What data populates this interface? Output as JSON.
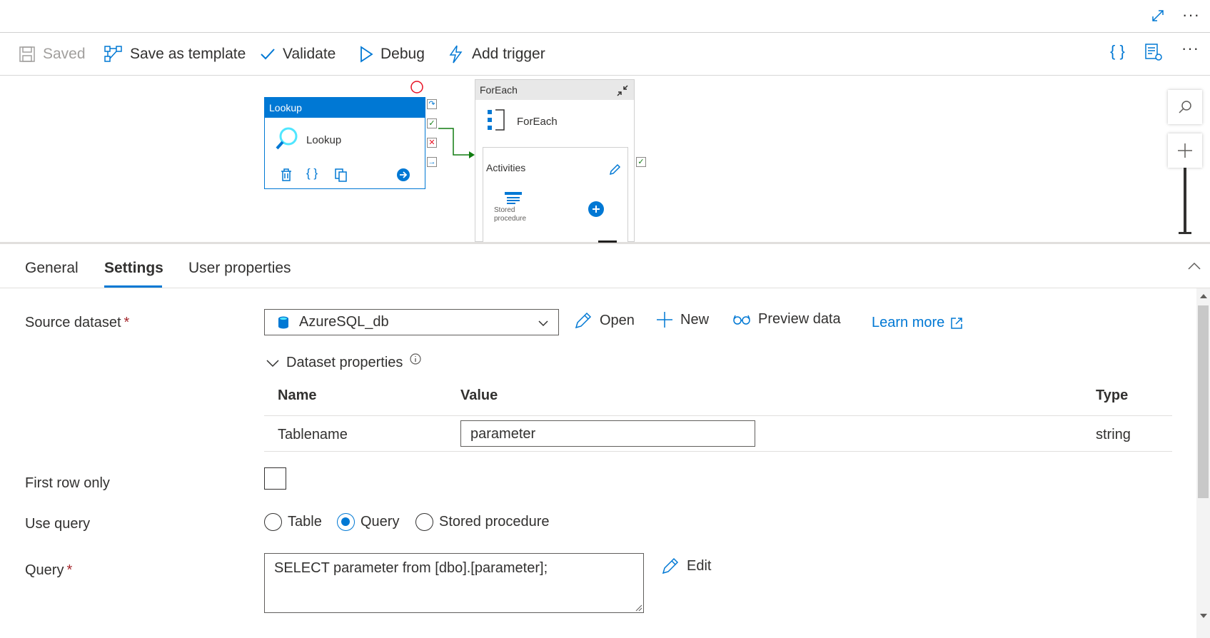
{
  "toolbar": {
    "saved_label": "Saved",
    "save_template_label": "Save as template",
    "validate_label": "Validate",
    "debug_label": "Debug",
    "add_trigger_label": "Add trigger",
    "json_icon_text": "{ }",
    "more_text": "···"
  },
  "canvas": {
    "lookup": {
      "header": "Lookup",
      "name": "Lookup"
    },
    "foreach": {
      "header": "ForEach",
      "name": "ForEach",
      "activities_label": "Activities",
      "inner_activity_line1": "Stored",
      "inner_activity_line2": "procedure"
    }
  },
  "tabs": [
    {
      "label": "General",
      "active": false
    },
    {
      "label": "Settings",
      "active": true
    },
    {
      "label": "User properties",
      "active": false
    }
  ],
  "settings": {
    "source_dataset_label": "Source dataset",
    "required_mark": "*",
    "source_dataset_value": "AzureSQL_db",
    "open_label": "Open",
    "new_label": "New",
    "preview_label": "Preview data",
    "learn_more_label": "Learn more",
    "dataset_properties_label": "Dataset properties",
    "table": {
      "headers": {
        "name": "Name",
        "value": "Value",
        "type": "Type"
      },
      "rows": [
        {
          "name": "Tablename",
          "value": "parameter",
          "type": "string"
        }
      ]
    },
    "first_row_only_label": "First row only",
    "first_row_only_checked": false,
    "use_query_label": "Use query",
    "use_query_options": [
      "Table",
      "Query",
      "Stored procedure"
    ],
    "use_query_selected": "Query",
    "query_label": "Query",
    "query_value": "SELECT parameter from [dbo].[parameter];",
    "edit_label": "Edit"
  },
  "colors": {
    "accent": "#0078d4",
    "success": "#107c10",
    "error": "#a4262c"
  }
}
